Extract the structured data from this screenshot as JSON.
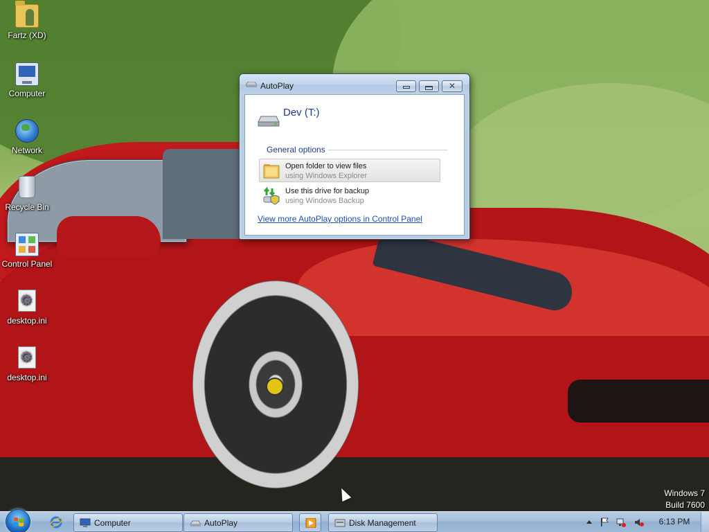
{
  "desktop": {
    "icons": [
      {
        "label": "Fartz (XD)",
        "icon": "user-folder-icon"
      },
      {
        "label": "Computer",
        "icon": "computer-icon"
      },
      {
        "label": "Network",
        "icon": "network-globe-icon"
      },
      {
        "label": "Recycle Bin",
        "icon": "recycle-bin-icon"
      },
      {
        "label": "Control Panel",
        "icon": "control-panel-icon"
      },
      {
        "label": "desktop.ini",
        "icon": "settings-file-icon"
      },
      {
        "label": "desktop.ini",
        "icon": "settings-file-icon"
      }
    ],
    "watermark": {
      "line1": "Windows 7",
      "line2": "Build 7600"
    }
  },
  "autoplay": {
    "title": "AutoPlay",
    "drive_name": "Dev (T:)",
    "section_label": "General options",
    "options": [
      {
        "title": "Open folder to view files",
        "subtitle": "using Windows Explorer",
        "icon": "folder-icon"
      },
      {
        "title": "Use this drive for backup",
        "subtitle": "using Windows Backup",
        "icon": "backup-icon"
      }
    ],
    "more_link": "View more AutoPlay options in Control Panel"
  },
  "taskbar": {
    "buttons": [
      {
        "label": "Computer",
        "icon": "computer-icon"
      },
      {
        "label": "AutoPlay",
        "icon": "autoplay-icon"
      },
      {
        "label": "",
        "icon": "media-player-icon"
      },
      {
        "label": "Disk Management",
        "icon": "disk-management-icon"
      }
    ],
    "clock": "6:13 PM"
  },
  "colors": {
    "window_frame": "#b6cde3",
    "link": "#1e4fb4",
    "heading": "#1e3c88",
    "taskbar": "#a5bfdb"
  }
}
